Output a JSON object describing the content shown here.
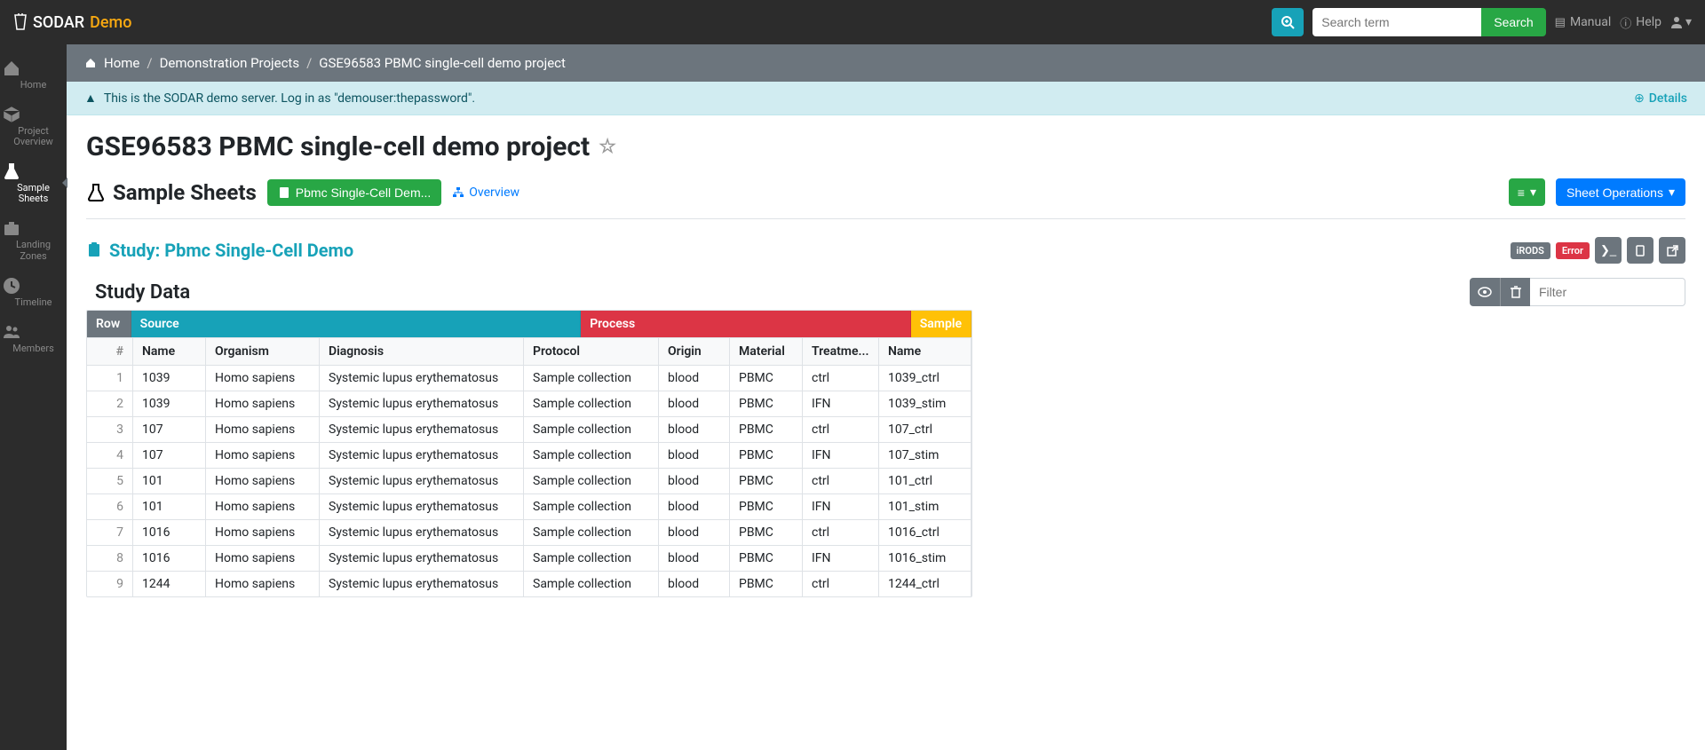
{
  "brand": {
    "main": "SODAR",
    "sub": "Demo"
  },
  "topbar": {
    "search_placeholder": "Search term",
    "search_btn": "Search",
    "manual": "Manual",
    "help": "Help"
  },
  "sidebar": {
    "items": [
      {
        "label": "Home"
      },
      {
        "label": "Project Overview"
      },
      {
        "label": "Sample Sheets"
      },
      {
        "label": "Landing Zones"
      },
      {
        "label": "Timeline"
      },
      {
        "label": "Members"
      }
    ]
  },
  "breadcrumb": {
    "home": "Home",
    "mid": "Demonstration Projects",
    "leaf": "GSE96583 PBMC single-cell demo project"
  },
  "alert": {
    "text": "This is the SODAR demo server. Log in as \"demouser:thepassword\".",
    "details": "Details"
  },
  "page_title": "GSE96583 PBMC single-cell demo project",
  "section": {
    "title": "Sample Sheets",
    "study_btn": "Pbmc Single-Cell Dem...",
    "overview": "Overview",
    "sheet_ops": "Sheet Operations"
  },
  "study": {
    "title": "Study: Pbmc Single-Cell Demo",
    "badge1": "iRODS",
    "badge2": "Error"
  },
  "table": {
    "title": "Study Data",
    "filter_placeholder": "Filter",
    "groups": {
      "row": "Row",
      "source": "Source",
      "process": "Process",
      "sample": "Sample"
    },
    "headers": {
      "idx": "#",
      "name": "Name",
      "organism": "Organism",
      "diagnosis": "Diagnosis",
      "protocol": "Protocol",
      "origin": "Origin",
      "material": "Material",
      "treatment": "Treatme...",
      "sname": "Name"
    },
    "rows": [
      {
        "idx": "1",
        "name": "1039",
        "organism": "Homo sapiens",
        "diagnosis": "Systemic lupus erythematosus",
        "protocol": "Sample collection",
        "origin": "blood",
        "material": "PBMC",
        "treatment": "ctrl",
        "sname": "1039_ctrl"
      },
      {
        "idx": "2",
        "name": "1039",
        "organism": "Homo sapiens",
        "diagnosis": "Systemic lupus erythematosus",
        "protocol": "Sample collection",
        "origin": "blood",
        "material": "PBMC",
        "treatment": "IFN",
        "sname": "1039_stim"
      },
      {
        "idx": "3",
        "name": "107",
        "organism": "Homo sapiens",
        "diagnosis": "Systemic lupus erythematosus",
        "protocol": "Sample collection",
        "origin": "blood",
        "material": "PBMC",
        "treatment": "ctrl",
        "sname": "107_ctrl"
      },
      {
        "idx": "4",
        "name": "107",
        "organism": "Homo sapiens",
        "diagnosis": "Systemic lupus erythematosus",
        "protocol": "Sample collection",
        "origin": "blood",
        "material": "PBMC",
        "treatment": "IFN",
        "sname": "107_stim"
      },
      {
        "idx": "5",
        "name": "101",
        "organism": "Homo sapiens",
        "diagnosis": "Systemic lupus erythematosus",
        "protocol": "Sample collection",
        "origin": "blood",
        "material": "PBMC",
        "treatment": "ctrl",
        "sname": "101_ctrl"
      },
      {
        "idx": "6",
        "name": "101",
        "organism": "Homo sapiens",
        "diagnosis": "Systemic lupus erythematosus",
        "protocol": "Sample collection",
        "origin": "blood",
        "material": "PBMC",
        "treatment": "IFN",
        "sname": "101_stim"
      },
      {
        "idx": "7",
        "name": "1016",
        "organism": "Homo sapiens",
        "diagnosis": "Systemic lupus erythematosus",
        "protocol": "Sample collection",
        "origin": "blood",
        "material": "PBMC",
        "treatment": "ctrl",
        "sname": "1016_ctrl"
      },
      {
        "idx": "8",
        "name": "1016",
        "organism": "Homo sapiens",
        "diagnosis": "Systemic lupus erythematosus",
        "protocol": "Sample collection",
        "origin": "blood",
        "material": "PBMC",
        "treatment": "IFN",
        "sname": "1016_stim"
      },
      {
        "idx": "9",
        "name": "1244",
        "organism": "Homo sapiens",
        "diagnosis": "Systemic lupus erythematosus",
        "protocol": "Sample collection",
        "origin": "blood",
        "material": "PBMC",
        "treatment": "ctrl",
        "sname": "1244_ctrl"
      }
    ]
  }
}
